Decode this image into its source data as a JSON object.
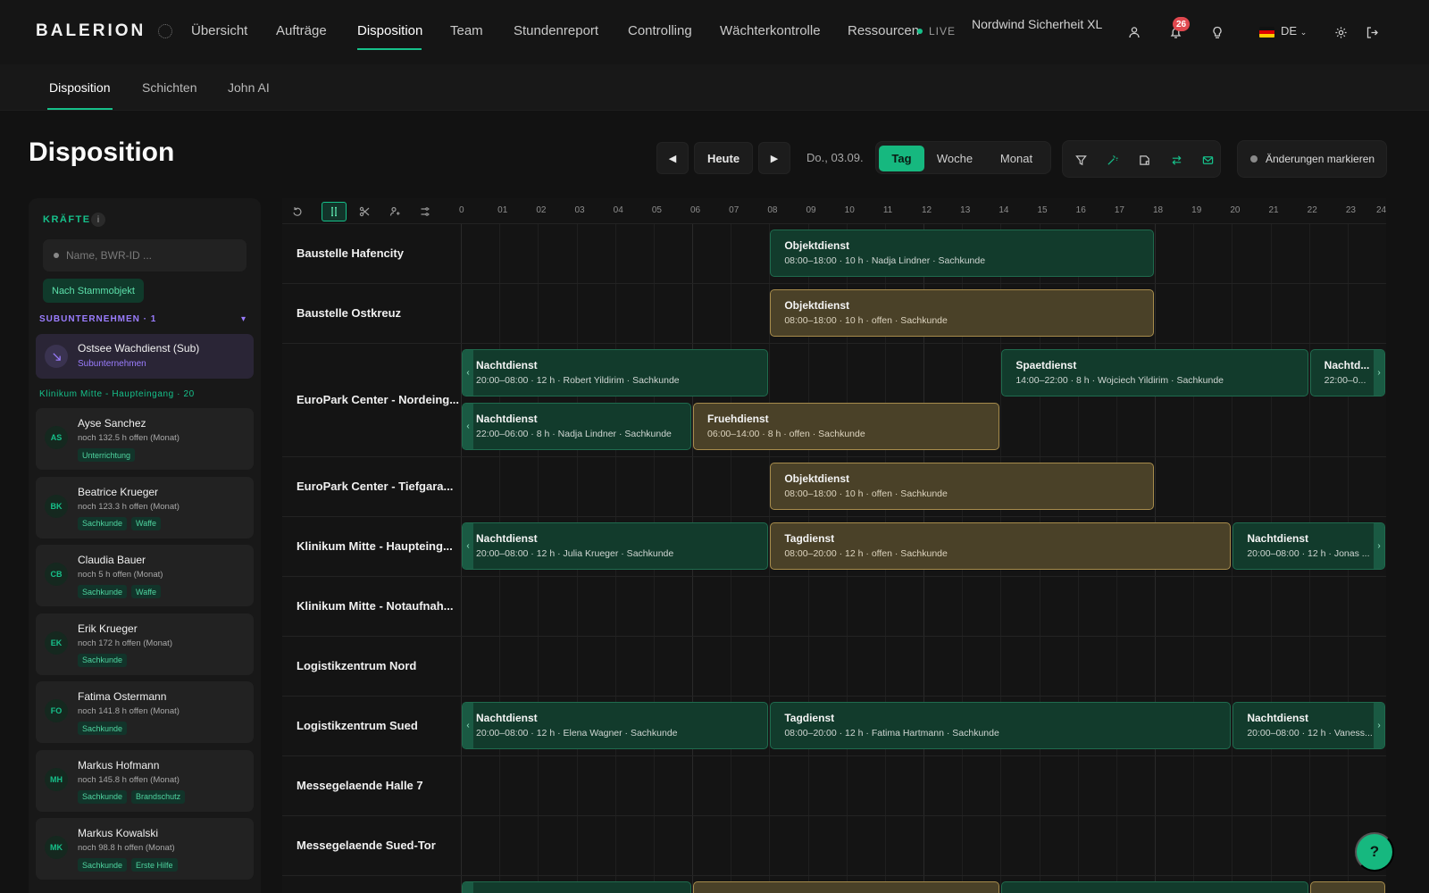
{
  "app": {
    "logo": "BALERION"
  },
  "nav": {
    "items": [
      "Übersicht",
      "Aufträge",
      "Disposition",
      "Team",
      "Stundenreport",
      "Controlling",
      "Wächterkontrolle",
      "Ressourcen"
    ],
    "active": "Disposition",
    "live_label": "LIVE",
    "company": "Nordwind Sicherheit XL",
    "notifications_count": "26",
    "language": "DE"
  },
  "subnav": {
    "items": [
      "Disposition",
      "Schichten",
      "John AI"
    ],
    "active": "Disposition"
  },
  "page": {
    "title": "Disposition"
  },
  "toolbar": {
    "prev_icon": "◀",
    "today_label": "Heute",
    "next_icon": "▶",
    "date": "Do., 03.09.",
    "views": [
      "Tag",
      "Woche",
      "Monat"
    ],
    "active_view": "Tag",
    "mark_changes_label": "Änderungen markieren",
    "icons": [
      "filter-icon",
      "magic-wand-icon",
      "note-icon",
      "swap-icon",
      "mail-icon"
    ]
  },
  "sidebar": {
    "title": "KRÄFTE",
    "info_icon": "i",
    "search_placeholder": "Name, BWR-ID ...",
    "group_chip": "Nach Stammobjekt",
    "subcontractors_heading": "SUBUNTERNEHMEN · 1",
    "subcontractor": {
      "name": "Ostsee Wachdienst (Sub)",
      "type": "Subunternehmen"
    },
    "object_heading": "Klinikum Mitte - Haupteingang · 20",
    "employees": [
      {
        "initials": "AS",
        "name": "Ayse Sanchez",
        "hours": "noch 132.5 h offen (Monat)",
        "tags": [
          "Unterrichtung"
        ]
      },
      {
        "initials": "BK",
        "name": "Beatrice Krueger",
        "hours": "noch 123.3 h offen (Monat)",
        "tags": [
          "Sachkunde",
          "Waffe"
        ]
      },
      {
        "initials": "CB",
        "name": "Claudia Bauer",
        "hours": "noch 5 h offen (Monat)",
        "tags": [
          "Sachkunde",
          "Waffe"
        ]
      },
      {
        "initials": "EK",
        "name": "Erik Krueger",
        "hours": "noch 172 h offen (Monat)",
        "tags": [
          "Sachkunde"
        ]
      },
      {
        "initials": "FO",
        "name": "Fatima Ostermann",
        "hours": "noch 141.8 h offen (Monat)",
        "tags": [
          "Sachkunde"
        ]
      },
      {
        "initials": "MH",
        "name": "Markus Hofmann",
        "hours": "noch 145.8 h offen (Monat)",
        "tags": [
          "Sachkunde",
          "Brandschutz"
        ]
      },
      {
        "initials": "MK",
        "name": "Markus Kowalski",
        "hours": "noch 98.8 h offen (Monat)",
        "tags": [
          "Sachkunde",
          "Erste Hilfe"
        ]
      }
    ]
  },
  "schedule": {
    "hours": [
      "0",
      "01",
      "02",
      "03",
      "04",
      "05",
      "06",
      "07",
      "08",
      "09",
      "10",
      "11",
      "12",
      "13",
      "14",
      "15",
      "16",
      "17",
      "18",
      "19",
      "20",
      "21",
      "22",
      "23",
      "24"
    ],
    "rows": [
      {
        "label": "Baustelle Hafencity",
        "lanes": 1,
        "shifts": [
          {
            "lane": 0,
            "start": 8,
            "end": 18,
            "status": "assigned",
            "title": "Objektdienst",
            "meta": "08:00–18:00 · 10 h · Nadja Lindner · Sachkunde"
          }
        ]
      },
      {
        "label": "Baustelle Ostkreuz",
        "lanes": 1,
        "shifts": [
          {
            "lane": 0,
            "start": 8,
            "end": 18,
            "status": "open",
            "title": "Objektdienst",
            "meta": "08:00–18:00 · 10 h · offen · Sachkunde"
          }
        ]
      },
      {
        "label": "EuroPark Center - Nordeing...",
        "lanes": 2,
        "shifts": [
          {
            "lane": 0,
            "start": 0,
            "end": 8,
            "status": "assigned",
            "title": "Nachtdienst",
            "meta": "20:00–08:00 · 12 h · Robert Yildirim · Sachkunde",
            "cont_left": true
          },
          {
            "lane": 0,
            "start": 14,
            "end": 22,
            "status": "assigned",
            "title": "Spaetdienst",
            "meta": "14:00–22:00 · 8 h · Wojciech Yildirim · Sachkunde"
          },
          {
            "lane": 0,
            "start": 22,
            "end": 24,
            "status": "assigned",
            "title": "Nachtd...",
            "meta": "22:00–0...",
            "cont_right": true
          },
          {
            "lane": 1,
            "start": 0,
            "end": 6,
            "status": "assigned",
            "title": "Nachtdienst",
            "meta": "22:00–06:00 · 8 h · Nadja Lindner · Sachkunde",
            "cont_left": true
          },
          {
            "lane": 1,
            "start": 6,
            "end": 14,
            "status": "open",
            "title": "Fruehdienst",
            "meta": "06:00–14:00 · 8 h · offen · Sachkunde"
          }
        ]
      },
      {
        "label": "EuroPark Center - Tiefgara...",
        "lanes": 1,
        "shifts": [
          {
            "lane": 0,
            "start": 8,
            "end": 18,
            "status": "open",
            "title": "Objektdienst",
            "meta": "08:00–18:00 · 10 h · offen · Sachkunde"
          }
        ]
      },
      {
        "label": "Klinikum Mitte - Haupteing...",
        "lanes": 1,
        "shifts": [
          {
            "lane": 0,
            "start": 0,
            "end": 8,
            "status": "assigned",
            "title": "Nachtdienst",
            "meta": "20:00–08:00 · 12 h · Julia Krueger · Sachkunde",
            "cont_left": true
          },
          {
            "lane": 0,
            "start": 8,
            "end": 20,
            "status": "open",
            "title": "Tagdienst",
            "meta": "08:00–20:00 · 12 h · offen · Sachkunde"
          },
          {
            "lane": 0,
            "start": 20,
            "end": 24,
            "status": "assigned",
            "title": "Nachtdienst",
            "meta": "20:00–08:00 · 12 h · Jonas ...",
            "cont_right": true
          }
        ]
      },
      {
        "label": "Klinikum Mitte - Notaufnah...",
        "lanes": 1,
        "shifts": []
      },
      {
        "label": "Logistikzentrum Nord",
        "lanes": 1,
        "shifts": []
      },
      {
        "label": "Logistikzentrum Sued",
        "lanes": 1,
        "shifts": [
          {
            "lane": 0,
            "start": 0,
            "end": 8,
            "status": "assigned",
            "title": "Nachtdienst",
            "meta": "20:00–08:00 · 12 h · Elena Wagner · Sachkunde",
            "cont_left": true
          },
          {
            "lane": 0,
            "start": 8,
            "end": 20,
            "status": "assigned",
            "title": "Tagdienst",
            "meta": "08:00–20:00 · 12 h · Fatima Hartmann · Sachkunde"
          },
          {
            "lane": 0,
            "start": 20,
            "end": 24,
            "status": "assigned",
            "title": "Nachtdienst",
            "meta": "20:00–08:00 · 12 h · Vaness...",
            "cont_right": true
          }
        ]
      },
      {
        "label": "Messegelaende Halle 7",
        "lanes": 1,
        "shifts": []
      },
      {
        "label": "Messegelaende Sued-Tor",
        "lanes": 1,
        "shifts": []
      },
      {
        "label": "",
        "lanes": 1,
        "shifts": [
          {
            "lane": 0,
            "start": 0,
            "end": 6,
            "status": "assigned",
            "title": "",
            "meta": "",
            "cont_left": true
          },
          {
            "lane": 0,
            "start": 6,
            "end": 14,
            "status": "open",
            "title": "",
            "meta": ""
          },
          {
            "lane": 0,
            "start": 14,
            "end": 22,
            "status": "assigned",
            "title": "",
            "meta": ""
          },
          {
            "lane": 0,
            "start": 22,
            "end": 24,
            "status": "open",
            "title": "",
            "meta": ""
          }
        ]
      }
    ]
  },
  "help": {
    "label": "?"
  },
  "colors": {
    "accent": "#16c08a",
    "assigned": "#123b2c",
    "open": "#4a4128",
    "subcontractor": "#9b7dff",
    "badge": "#e0484f"
  }
}
